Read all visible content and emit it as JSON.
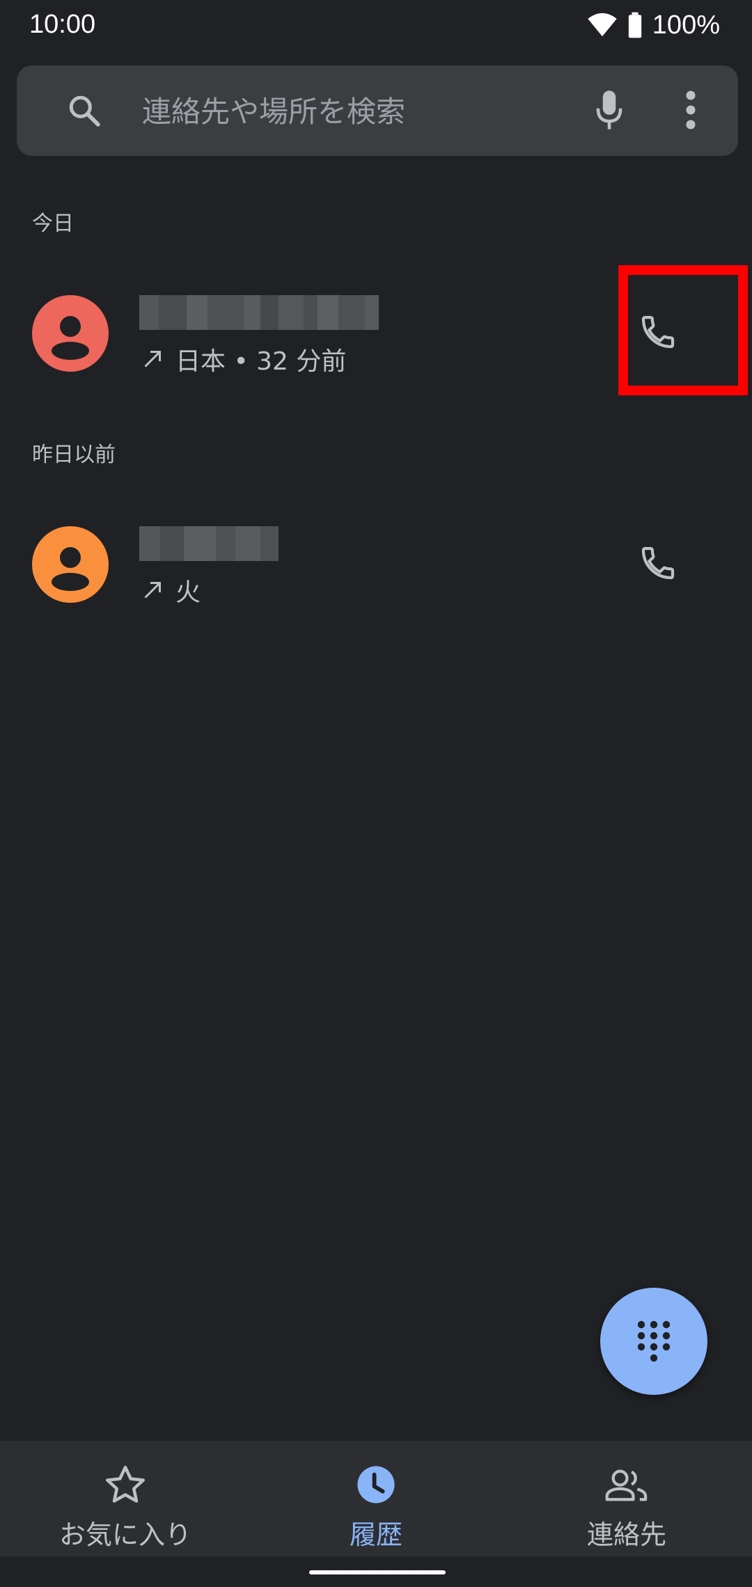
{
  "status_bar": {
    "time": "10:00",
    "battery": "100%"
  },
  "search": {
    "placeholder": "連絡先や場所を検索"
  },
  "sections": {
    "today": "今日",
    "earlier": "昨日以前"
  },
  "calls": [
    {
      "detail": "日本 • 32 分前",
      "avatar_color": "#ee675c",
      "direction_icon": "outgoing-arrow-icon"
    },
    {
      "detail": "火",
      "avatar_color": "#fa903e",
      "direction_icon": "outgoing-arrow-icon"
    }
  ],
  "bottom_nav": {
    "favorites": "お気に入り",
    "recents": "履歴",
    "contacts": "連絡先",
    "active": "recents"
  },
  "colors": {
    "accent": "#8ab4f8",
    "background": "#202124",
    "highlight": "#ff0000"
  }
}
